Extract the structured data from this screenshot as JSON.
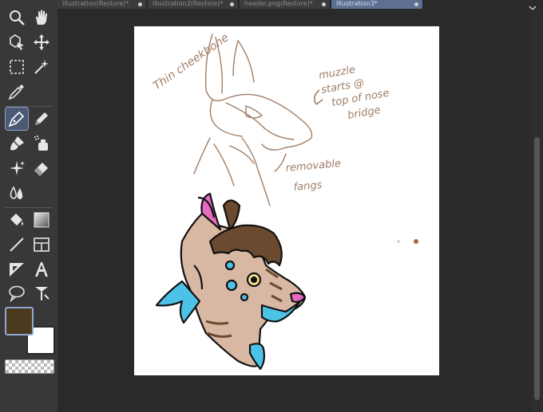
{
  "tabs": [
    {
      "label": "Illustration(Restore)*",
      "active": false
    },
    {
      "label": "Illustration2(Restore)*",
      "active": false
    },
    {
      "label": "header.png(Restore)*",
      "active": false
    },
    {
      "label": "Illustration3*",
      "active": true
    }
  ],
  "tools": [
    {
      "name": "zoom-tool",
      "icon": "magnifier-icon"
    },
    {
      "name": "hand-tool",
      "icon": "hand-icon"
    },
    {
      "name": "object-tool",
      "icon": "object-arrow-icon"
    },
    {
      "name": "move-layer-tool",
      "icon": "move-icon"
    },
    {
      "name": "selection-tool",
      "icon": "marquee-icon"
    },
    {
      "name": "auto-select-tool",
      "icon": "magic-wand-icon"
    },
    {
      "name": "eyedropper-tool",
      "icon": "eyedropper-icon"
    },
    {
      "name": "pen-tool",
      "icon": "pen-icon",
      "selected": true
    },
    {
      "name": "pencil-tool",
      "icon": "pencil-icon"
    },
    {
      "name": "brush-tool",
      "icon": "brush-icon"
    },
    {
      "name": "airbrush-tool",
      "icon": "airbrush-icon"
    },
    {
      "name": "decoration-tool",
      "icon": "sparkle-icon"
    },
    {
      "name": "eraser-tool",
      "icon": "eraser-icon"
    },
    {
      "name": "blend-tool",
      "icon": "blend-drops-icon"
    },
    {
      "name": "fill-tool",
      "icon": "bucket-icon"
    },
    {
      "name": "gradient-tool",
      "icon": "gradient-icon"
    },
    {
      "name": "figure-tool",
      "icon": "line-icon"
    },
    {
      "name": "frame-border-tool",
      "icon": "frame-icon"
    },
    {
      "name": "ruler-tool",
      "icon": "ruler-triangle-icon"
    },
    {
      "name": "text-tool",
      "icon": "text-a-icon"
    },
    {
      "name": "balloon-tool",
      "icon": "balloon-icon"
    },
    {
      "name": "correct-line-tool",
      "icon": "correct-line-icon"
    }
  ],
  "colors": {
    "main": "#4b3a1f",
    "sub": "#ffffff",
    "accent": "#5d6f92"
  },
  "canvas": {
    "notes": [
      "Thin cheekbone",
      "muzzle starts @ top of nose bridge",
      "removable fangs"
    ]
  }
}
